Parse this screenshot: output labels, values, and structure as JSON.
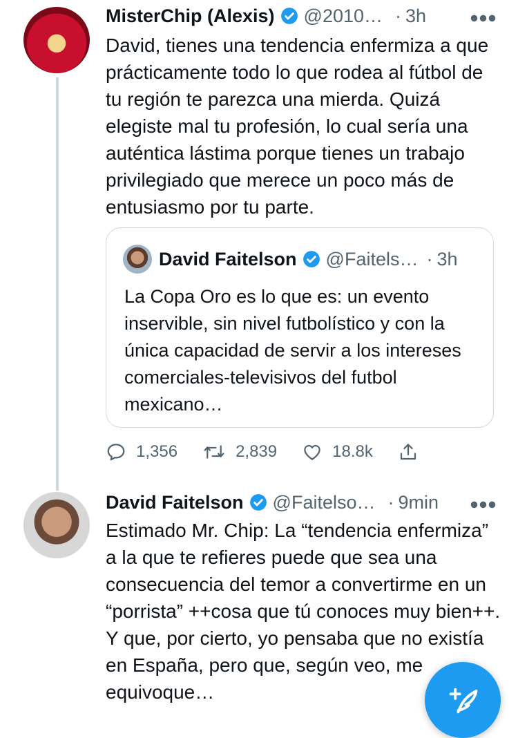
{
  "tweets": [
    {
      "author_name": "MisterChip (Alexis)",
      "handle": "@2010…",
      "time": "3h",
      "text": "David, tienes una tendencia enfermiza a que prácticamente todo lo que rodea al fútbol de tu región te parezca una mierda. Quizá elegiste mal tu profesión, lo cual sería una auténtica lástima porque tienes un trabajo privilegiado que merece un poco más de entusiasmo por tu parte.",
      "quoted": {
        "author_name": "David Faitelson",
        "handle": "@Faitels…",
        "time": "3h",
        "text": "La Copa Oro es lo que es: un evento inservible,  sin nivel futbolístico y con la única capacidad de servir a los intereses comerciales-televisivos del futbol mexicano…"
      },
      "actions": {
        "replies": "1,356",
        "retweets": "2,839",
        "likes": "18.8k"
      }
    },
    {
      "author_name": "David Faitelson",
      "handle": "@Faitelso…",
      "time": "9min",
      "text": "Estimado Mr. Chip: La “tendencia enfermiza” a la que te refieres puede que sea una consecuencia del temor a convertirme en un “porrista” ++cosa que tú conoces muy bien++. Y que, por cierto,  yo pensaba que no existía en España, pero que, según veo, me equivoque…"
    }
  ],
  "icons": {
    "verified": "verified-badge-icon",
    "more": "more-options-icon",
    "reply": "reply-icon",
    "retweet": "retweet-icon",
    "like": "heart-icon",
    "share": "share-icon",
    "compose": "compose-tweet-icon"
  },
  "colors": {
    "accent": "#1d9bf0",
    "secondary_text": "#536471",
    "border": "#cfd9de"
  }
}
